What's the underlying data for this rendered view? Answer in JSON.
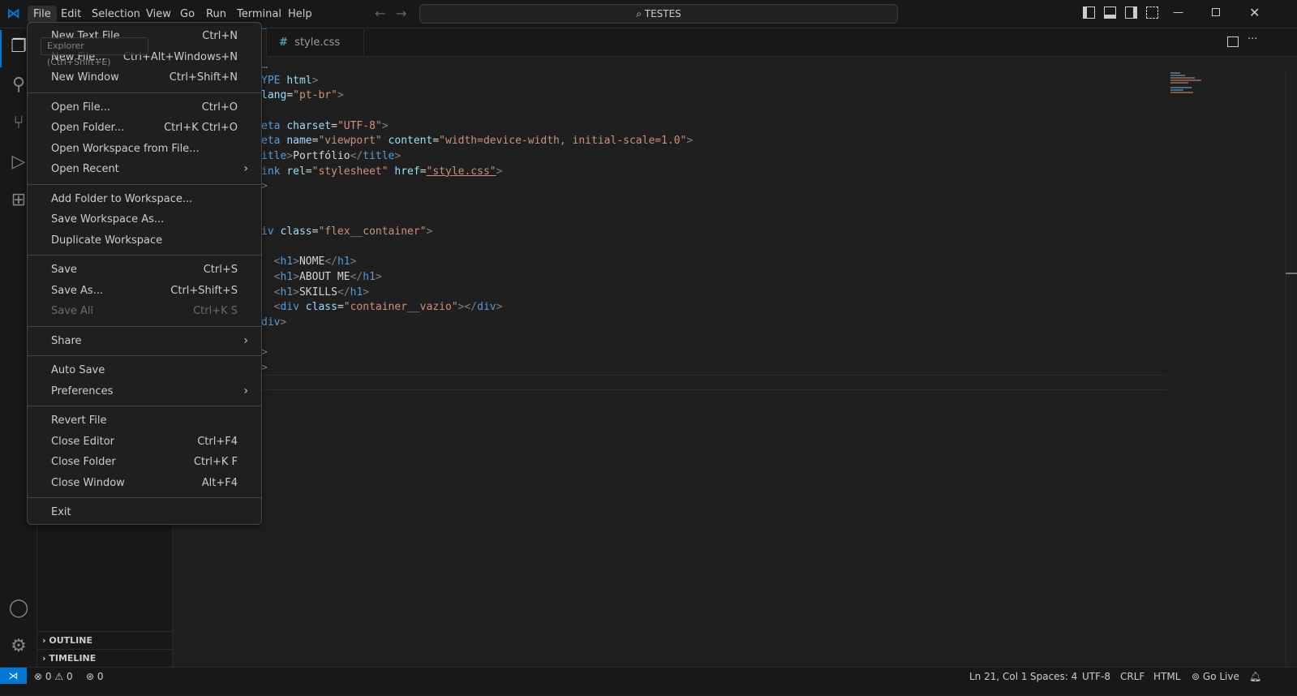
{
  "titlebar": {
    "menus": [
      "File",
      "Edit",
      "Selection",
      "View",
      "Go",
      "Run",
      "Terminal",
      "Help"
    ],
    "search": "TESTES"
  },
  "tooltip": "Explorer (Ctrl+Shift+E)",
  "sidebar": {
    "sections": [
      "OUTLINE",
      "TIMELINE"
    ]
  },
  "tabs": [
    {
      "label": "style.css",
      "icon": "#"
    }
  ],
  "file_menu": [
    [
      {
        "label": "New Text File",
        "key": "Ctrl+N"
      },
      {
        "label": "New File...",
        "key": "Ctrl+Alt+Windows+N"
      },
      {
        "label": "New Window",
        "key": "Ctrl+Shift+N"
      }
    ],
    [
      {
        "label": "Open File...",
        "key": "Ctrl+O"
      },
      {
        "label": "Open Folder...",
        "key": "Ctrl+K Ctrl+O"
      },
      {
        "label": "Open Workspace from File...",
        "key": ""
      },
      {
        "label": "Open Recent",
        "key": "",
        "submenu": true
      }
    ],
    [
      {
        "label": "Add Folder to Workspace...",
        "key": ""
      },
      {
        "label": "Save Workspace As...",
        "key": ""
      },
      {
        "label": "Duplicate Workspace",
        "key": ""
      }
    ],
    [
      {
        "label": "Save",
        "key": "Ctrl+S"
      },
      {
        "label": "Save As...",
        "key": "Ctrl+Shift+S"
      },
      {
        "label": "Save All",
        "key": "Ctrl+K S",
        "disabled": true
      }
    ],
    [
      {
        "label": "Share",
        "key": "",
        "submenu": true
      }
    ],
    [
      {
        "label": "Auto Save",
        "key": ""
      },
      {
        "label": "Preferences",
        "key": "",
        "submenu": true
      }
    ],
    [
      {
        "label": "Revert File",
        "key": ""
      },
      {
        "label": "Close Editor",
        "key": "Ctrl+F4"
      },
      {
        "label": "Close Folder",
        "key": "Ctrl+K F"
      },
      {
        "label": "Close Window",
        "key": "Alt+F4"
      }
    ],
    [
      {
        "label": "Exit",
        "key": ""
      }
    ]
  ],
  "code_lines": [
    [
      [
        "g",
        "…"
      ]
    ],
    [
      [
        "t",
        "YPE "
      ],
      [
        "a",
        "html"
      ],
      [
        "g",
        ">"
      ]
    ],
    [
      [
        "a",
        "lang"
      ],
      [
        "w",
        "="
      ],
      [
        "s",
        "\"pt-br\""
      ],
      [
        "g",
        ">"
      ]
    ],
    [],
    [
      [
        "t",
        "eta "
      ],
      [
        "a",
        "charset"
      ],
      [
        "w",
        "="
      ],
      [
        "s",
        "\"UTF-8\""
      ],
      [
        "g",
        ">"
      ]
    ],
    [
      [
        "t",
        "eta "
      ],
      [
        "a",
        "name"
      ],
      [
        "w",
        "="
      ],
      [
        "s",
        "\"viewport\" "
      ],
      [
        "a",
        "content"
      ],
      [
        "w",
        "="
      ],
      [
        "s",
        "\"width=device-width, initial-scale=1.0\""
      ],
      [
        "g",
        ">"
      ]
    ],
    [
      [
        "t",
        "itle"
      ],
      [
        "g",
        ">"
      ],
      [
        "w",
        "Portfólio"
      ],
      [
        "g",
        "</"
      ],
      [
        "t",
        "title"
      ],
      [
        "g",
        ">"
      ]
    ],
    [
      [
        "t",
        "ink "
      ],
      [
        "a",
        "rel"
      ],
      [
        "w",
        "="
      ],
      [
        "s",
        "\"stylesheet\" "
      ],
      [
        "a",
        "href"
      ],
      [
        "w",
        "="
      ],
      [
        "s",
        "\"style.css\""
      ],
      [
        "g",
        ">"
      ]
    ],
    [
      [
        "g",
        ">"
      ]
    ],
    [],
    [],
    [
      [
        "t",
        "iv "
      ],
      [
        "a",
        "class"
      ],
      [
        "w",
        "="
      ],
      [
        "s",
        "\"flex__container\""
      ],
      [
        "g",
        ">"
      ]
    ],
    [],
    [
      [
        "w",
        "  "
      ],
      [
        "g",
        "<"
      ],
      [
        "t",
        "h1"
      ],
      [
        "g",
        ">"
      ],
      [
        "w",
        "NOME"
      ],
      [
        "g",
        "</"
      ],
      [
        "t",
        "h1"
      ],
      [
        "g",
        ">"
      ]
    ],
    [
      [
        "w",
        "  "
      ],
      [
        "g",
        "<"
      ],
      [
        "t",
        "h1"
      ],
      [
        "g",
        ">"
      ],
      [
        "w",
        "ABOUT ME"
      ],
      [
        "g",
        "</"
      ],
      [
        "t",
        "h1"
      ],
      [
        "g",
        ">"
      ]
    ],
    [
      [
        "w",
        "  "
      ],
      [
        "g",
        "<"
      ],
      [
        "t",
        "h1"
      ],
      [
        "g",
        ">"
      ],
      [
        "w",
        "SKILLS"
      ],
      [
        "g",
        "</"
      ],
      [
        "t",
        "h1"
      ],
      [
        "g",
        ">"
      ]
    ],
    [
      [
        "w",
        "  "
      ],
      [
        "g",
        "<"
      ],
      [
        "t",
        "div "
      ],
      [
        "a",
        "class"
      ],
      [
        "w",
        "="
      ],
      [
        "s",
        "\"container__vazio\""
      ],
      [
        "g",
        "></"
      ],
      [
        "t",
        "div"
      ],
      [
        "g",
        ">"
      ]
    ],
    [
      [
        "t",
        "div"
      ],
      [
        "g",
        ">"
      ]
    ],
    [],
    [
      [
        "g",
        ">"
      ]
    ],
    [
      [
        "g",
        ">"
      ]
    ]
  ],
  "statusbar": {
    "errors": "0",
    "warnings": "0",
    "ports": "0",
    "position": "Ln 21, Col 1",
    "spaces": "Spaces: 4",
    "encoding": "UTF-8",
    "eol": "CRLF",
    "language": "HTML",
    "golive": "Go Live"
  },
  "colors": {
    "accent": "#0078d4",
    "tag": "#569cd6",
    "attr": "#9cdcfe",
    "string": "#ce9178"
  }
}
